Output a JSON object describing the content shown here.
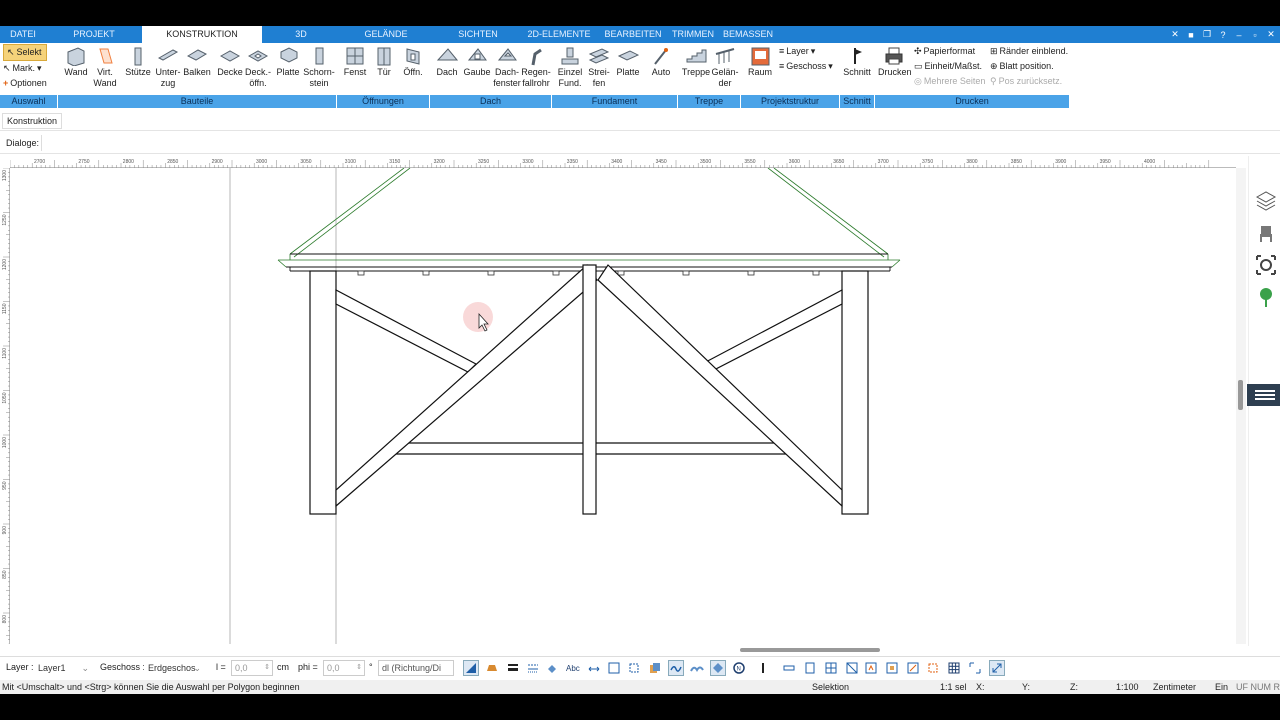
{
  "tabs": [
    {
      "label": "DATEI",
      "active": false
    },
    {
      "label": "PROJEKT",
      "active": false
    },
    {
      "label": "KONSTRUKTION",
      "active": true
    },
    {
      "label": "3D",
      "active": false
    },
    {
      "label": "GELÄNDE",
      "active": false
    },
    {
      "label": "SICHTEN",
      "active": false
    },
    {
      "label": "2D-ELEMENTE",
      "active": false
    },
    {
      "label": "BEARBEITEN",
      "active": false
    },
    {
      "label": "TRIMMEN",
      "active": false
    },
    {
      "label": "BEMASSEN",
      "active": false
    }
  ],
  "ribbon": {
    "auswahl": {
      "selekt": "Selekt",
      "mark": "Mark.",
      "optionen": "Optionen"
    },
    "bauteile": [
      {
        "l1": "Wand",
        "l2": "",
        "icon": "wall-icon"
      },
      {
        "l1": "Virt.",
        "l2": "Wand",
        "icon": "virtual-wall-icon"
      },
      {
        "l1": "Stütze",
        "l2": "",
        "icon": "column-icon"
      },
      {
        "l1": "Unter-",
        "l2": "zug",
        "icon": "beam-under-icon"
      },
      {
        "l1": "Balken",
        "l2": "",
        "icon": "beam-icon"
      },
      {
        "l1": "Decke",
        "l2": "",
        "icon": "ceiling-icon"
      },
      {
        "l1": "Deck.-",
        "l2": "öffn.",
        "icon": "ceiling-opening-icon"
      },
      {
        "l1": "Platte",
        "l2": "",
        "icon": "slab-icon"
      },
      {
        "l1": "Schorn-",
        "l2": "stein",
        "icon": "chimney-icon"
      }
    ],
    "oeffnungen": [
      {
        "l1": "Fenst",
        "l2": "",
        "icon": "window-icon"
      },
      {
        "l1": "Tür",
        "l2": "",
        "icon": "door-icon"
      },
      {
        "l1": "Öffn.",
        "l2": "",
        "icon": "opening-icon"
      }
    ],
    "dach": [
      {
        "l1": "Dach",
        "l2": "",
        "icon": "roof-icon"
      },
      {
        "l1": "Gaube",
        "l2": "",
        "icon": "dormer-icon"
      },
      {
        "l1": "Dach-",
        "l2": "fenster",
        "icon": "roof-window-icon"
      },
      {
        "l1": "Regen-",
        "l2": "fallrohr",
        "icon": "downpipe-icon"
      }
    ],
    "fundament": [
      {
        "l1": "Einzel",
        "l2": "Fund.",
        "icon": "single-foundation-icon"
      },
      {
        "l1": "Strei-",
        "l2": "fen",
        "icon": "strip-foundation-icon"
      },
      {
        "l1": "Platte",
        "l2": "",
        "icon": "foundation-slab-icon"
      },
      {
        "l1": "Auto",
        "l2": "",
        "icon": "auto-icon"
      }
    ],
    "treppe": [
      {
        "l1": "Treppe",
        "l2": "",
        "icon": "stairs-icon"
      },
      {
        "l1": "Gelän-",
        "l2": "der",
        "icon": "railing-icon"
      }
    ],
    "projektstruktur": {
      "raum": "Raum",
      "layer": "Layer",
      "geschoss": "Geschoss"
    },
    "schnitt": "Schnitt",
    "drucken": {
      "drucken": "Drucken",
      "papierformat": "Papierformat",
      "einheit": "Einheit/Maßst.",
      "mehrere": "Mehrere Seiten",
      "raender": "Ränder einblend.",
      "blatt": "Blatt position.",
      "pos": "Pos zurücksetz."
    }
  },
  "groups": [
    "Auswahl",
    "Bauteile",
    "Öffnungen",
    "Dach",
    "Fundament",
    "Treppe",
    "Projektstruktur",
    "Schnitt",
    "Drucken"
  ],
  "doc_tab": "Konstruktion",
  "dialoge_label": "Dialoge:",
  "ruler_top": [
    "2700",
    "2750",
    "2800",
    "2850",
    "2900",
    "3000",
    "3050",
    "3100",
    "3150",
    "3200",
    "3250",
    "3300",
    "3350",
    "3400",
    "3450",
    "3500",
    "3550",
    "3600",
    "3650",
    "3700",
    "3750",
    "3800",
    "3850",
    "3900",
    "3950",
    "4000"
  ],
  "ruler_left": [
    "1300",
    "1250",
    "1200",
    "1150",
    "1100",
    "1050",
    "1000",
    "950",
    "900",
    "850",
    "800"
  ],
  "bottom": {
    "layer_label": "Layer :",
    "layer_value": "Layer1",
    "geschoss_label": "Geschoss :",
    "geschoss_value": "Erdgeschos",
    "l_label": "l =",
    "l_value": "0,0",
    "l_unit": "cm",
    "phi_label": "phi =",
    "phi_value": "0,0",
    "phi_unit": "°",
    "dl_value": "dl (Richtung/Di"
  },
  "status": {
    "hint": "Mit <Umschalt> und <Strg> können Sie die Auswahl per Polygon beginnen",
    "mode": "Selektion",
    "sel": "1:1 sel",
    "x": "X:",
    "y": "Y:",
    "z": "Z:",
    "scale": "1:100",
    "unit": "Zentimeter",
    "ein": "Ein",
    "num": "UF NUM R"
  },
  "colors": {
    "accent": "#1f7fd2",
    "group_bar": "#4aa3e8",
    "roof_line": "#2a7a2a",
    "selection_btn": "#f5d27a"
  }
}
